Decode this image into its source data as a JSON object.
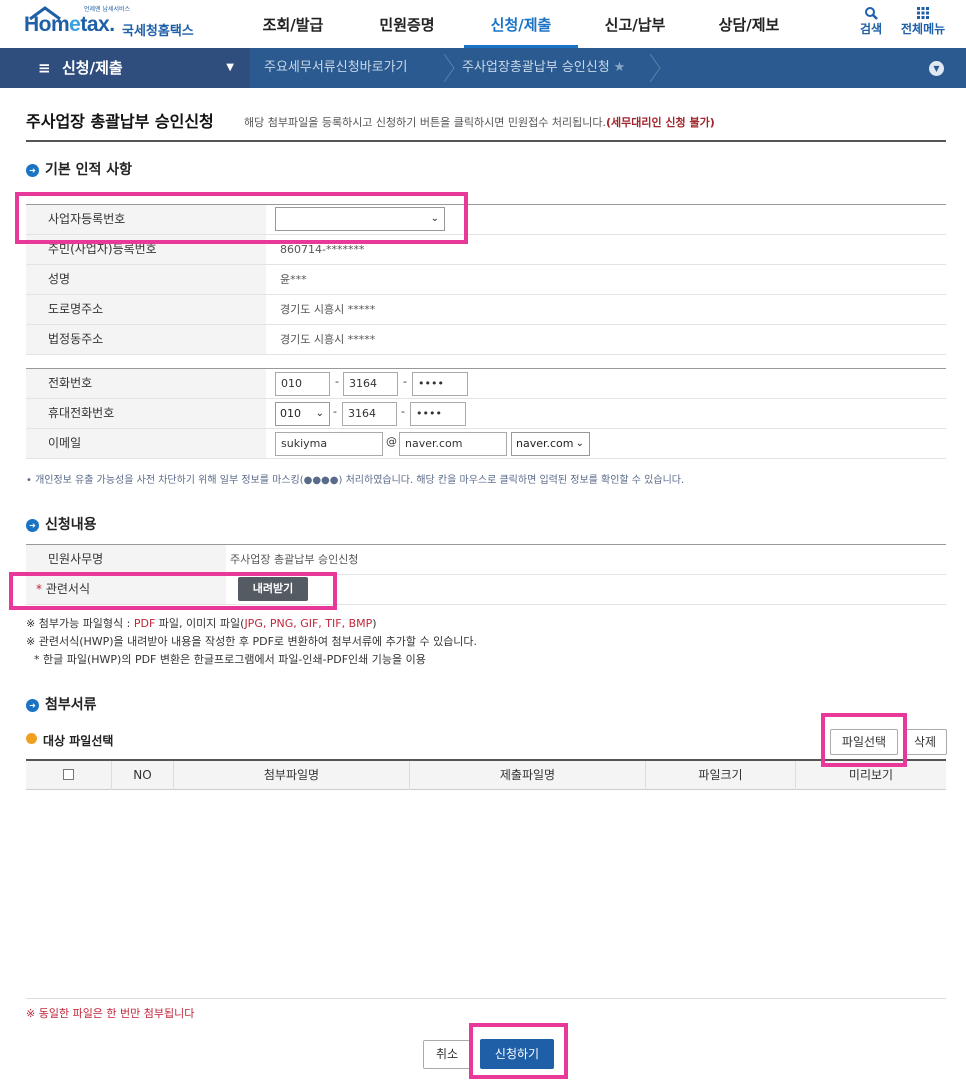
{
  "header": {
    "logo_small": "언제엔 납세서비스",
    "logo_text_pre": "Hom",
    "logo_text_e": "e",
    "logo_text_post": "tax.",
    "logo_kr": "국세청홈택스",
    "gnb": [
      "조회/발급",
      "민원증명",
      "신청/제출",
      "신고/납부",
      "상담/제보"
    ],
    "search_label": "검색",
    "menu_label": "전체메뉴"
  },
  "navbar": {
    "current": "신청/제출",
    "crumb1": "주요세무서류신청바로가기",
    "crumb2": "주사업장총괄납부 승인신청"
  },
  "page": {
    "title": "주사업장 총괄납부 승인신청",
    "desc": "해당 첨부파일을 등록하시고 신청하기 버튼을 클릭하시면 민원접수 처리됩니다.",
    "desc_warn": "(세무대리인 신청 불가)"
  },
  "basic": {
    "section_title": "기본 인적 사항",
    "rows": [
      {
        "label": "사업자등록번호",
        "value": ""
      },
      {
        "label": "주민(사업자)등록번호",
        "value": "860714-*******"
      },
      {
        "label": "성명",
        "value": "윤***"
      },
      {
        "label": "도로명주소",
        "value": "경기도 시흥시 *****"
      },
      {
        "label": "법정동주소",
        "value": "경기도 시흥시 *****"
      }
    ],
    "phone_label": "전화번호",
    "phone": [
      "010",
      "3164",
      "••••"
    ],
    "mobile_label": "휴대전화번호",
    "mobile": [
      "010",
      "3164",
      "••••"
    ],
    "email_label": "이메일",
    "email_id": "sukiyma",
    "email_at": "@",
    "email_domain": "naver.com",
    "email_select": "naver.com",
    "dash": "-",
    "note": "• 개인정보 유출 가능성을 사전 차단하기 위해 일부 정보를 마스킹(●●●●) 처리하였습니다. 해당 칸을 마우스로 클릭하면 입력된 정보를 확인할 수 있습니다."
  },
  "apply": {
    "section_title": "신청내용",
    "row1_label": "민원사무명",
    "row1_value": "주사업장 총괄납부 승인신청",
    "row2_required": "*",
    "row2_label": "관련서식",
    "download_button": "내려받기",
    "info1_prefix": "※ 첨부가능 파일형식 : ",
    "info1_pdf": "PDF",
    "info1_mid": " 파일, 이미지 파일(",
    "info1_types": "JPG, PNG, GIF, TIF, BMP",
    "info1_end": ")",
    "info2": "※ 관련서식(HWP)을 내려받아 내용을 작성한 후 PDF로 변환하여 첨부서류에 추가할 수 있습니다.",
    "info3": "* 한글 파일(HWP)의 PDF 변환은 한글프로그램에서 파일-인쇄-PDF인쇄 기능을 이용"
  },
  "attach": {
    "section_title": "첨부서류",
    "sub_title": "대상 파일선택",
    "select_button": "파일선택",
    "delete_button": "삭제",
    "columns": [
      "NO",
      "첨부파일명",
      "제출파일명",
      "파일크기",
      "미리보기"
    ],
    "dup_note": "※ 동일한 파일은 한 번만 첨부됩니다"
  },
  "actions": {
    "cancel": "취소",
    "submit": "신청하기"
  },
  "colors": {
    "brand": "#1f5fa8",
    "highlight": "#e8389a",
    "warn": "#a0262e"
  }
}
